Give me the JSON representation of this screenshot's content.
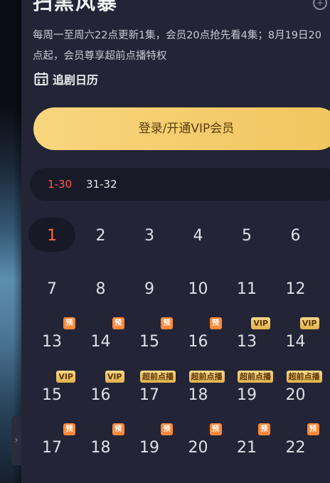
{
  "drama": {
    "title": "扫黑风暴",
    "description": "每周一至周六22点更新1集，会员20点抢先看4集；8月19日20点起，会员尊享超前点播特权",
    "calendar_label": "追剧日历"
  },
  "vip_button_label": "登录/开通VIP会员",
  "range_tabs": [
    {
      "label": "1-30",
      "active": true
    },
    {
      "label": "31-32",
      "active": false
    }
  ],
  "episodes": [
    {
      "num": "1",
      "badge": ""
    },
    {
      "num": "2",
      "badge": ""
    },
    {
      "num": "3",
      "badge": ""
    },
    {
      "num": "4",
      "badge": ""
    },
    {
      "num": "5",
      "badge": ""
    },
    {
      "num": "6",
      "badge": ""
    },
    {
      "num": "7",
      "badge": ""
    },
    {
      "num": "8",
      "badge": ""
    },
    {
      "num": "9",
      "badge": ""
    },
    {
      "num": "10",
      "badge": ""
    },
    {
      "num": "11",
      "badge": ""
    },
    {
      "num": "12",
      "badge": ""
    },
    {
      "num": "13",
      "badge": "预"
    },
    {
      "num": "14",
      "badge": "预"
    },
    {
      "num": "15",
      "badge": "预"
    },
    {
      "num": "16",
      "badge": "预"
    },
    {
      "num": "13",
      "badge": "VIP"
    },
    {
      "num": "14",
      "badge": "VIP"
    },
    {
      "num": "15",
      "badge": "VIP"
    },
    {
      "num": "16",
      "badge": "VIP"
    },
    {
      "num": "17",
      "badge": "超前点播"
    },
    {
      "num": "18",
      "badge": "超前点播"
    },
    {
      "num": "19",
      "badge": "超前点播"
    },
    {
      "num": "20",
      "badge": "超前点播"
    },
    {
      "num": "17",
      "badge": "预"
    },
    {
      "num": "18",
      "badge": "预"
    },
    {
      "num": "19",
      "badge": "预"
    },
    {
      "num": "20",
      "badge": "预"
    },
    {
      "num": "21",
      "badge": "预"
    },
    {
      "num": "22",
      "badge": "预"
    }
  ],
  "selected_episode": "1",
  "colors": {
    "accent": "#ff5a4d",
    "vip_gold": "#f3c862",
    "background": "#232536"
  }
}
